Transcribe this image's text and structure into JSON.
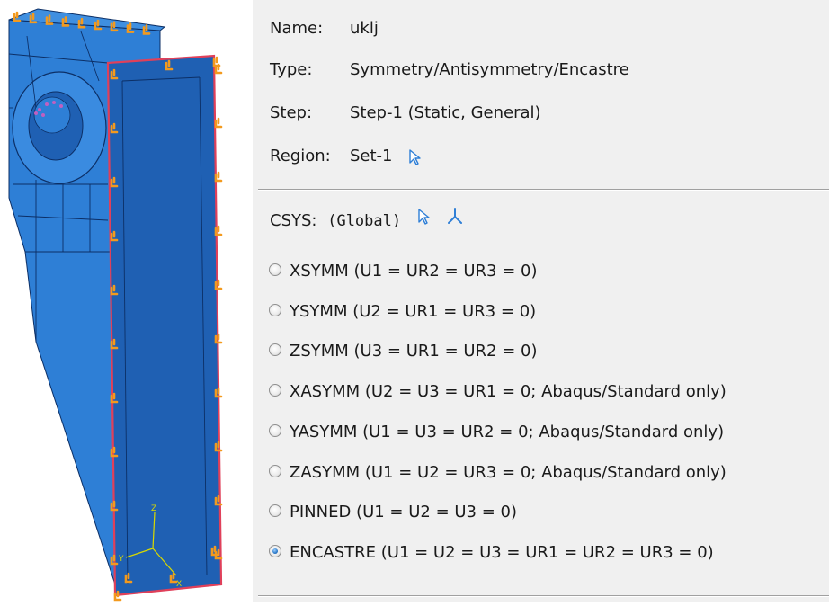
{
  "bc": {
    "name_label": "Name:",
    "name_value": "uklj",
    "type_label": "Type:",
    "type_value": "Symmetry/Antisymmetry/Encastre",
    "step_label": "Step:",
    "step_value": "Step-1 (Static, General)",
    "region_label": "Region:",
    "region_value": "Set-1"
  },
  "csys": {
    "label": "CSYS:",
    "value": "(Global)"
  },
  "options": [
    {
      "label": "XSYMM (U1 = UR2 = UR3 = 0)",
      "selected": false
    },
    {
      "label": "YSYMM (U2 = UR1 = UR3 = 0)",
      "selected": false
    },
    {
      "label": "ZSYMM (U3 = UR1 = UR2 = 0)",
      "selected": false
    },
    {
      "label": "XASYMM (U2 = U3 = UR1 = 0; Abaqus/Standard only)",
      "selected": false
    },
    {
      "label": "YASYMM (U1 = U3 = UR2 = 0; Abaqus/Standard only)",
      "selected": false
    },
    {
      "label": "ZASYMM (U1 = U2 = UR3 = 0; Abaqus/Standard only)",
      "selected": false
    },
    {
      "label": "PINNED (U1 = U2 = U3 = 0)",
      "selected": false
    },
    {
      "label": "ENCASTRE (U1 = U2 = U3 = UR1 = UR2 = UR3 = 0)",
      "selected": true
    }
  ],
  "viewport": {
    "triad_labels": [
      "Z",
      "Y",
      "X"
    ],
    "colors": {
      "part_fill": "#2e7fd6",
      "part_face_dark": "#1f60b3",
      "mesh_line": "#0c2f66",
      "bc_marker": "#f39a1e",
      "highlight_edge": "#e0405a",
      "triad": "#d9d900"
    }
  },
  "icons": {
    "region_pick": "arrow-cursor-icon",
    "csys_pick": "arrow-cursor-icon",
    "csys_create": "csys-triad-icon"
  }
}
